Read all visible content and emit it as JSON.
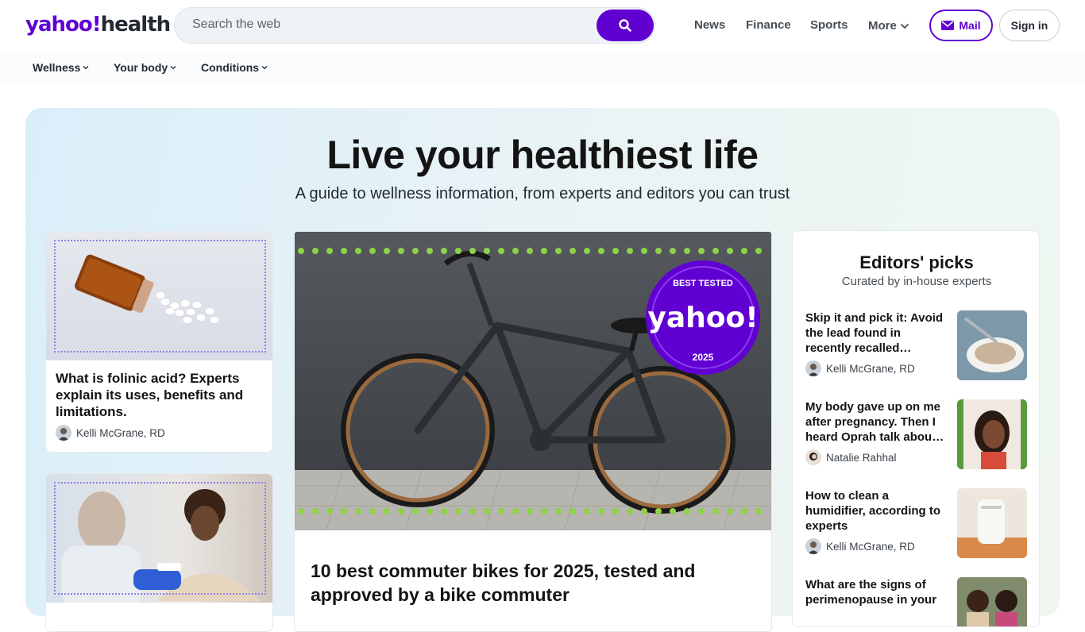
{
  "header": {
    "logo_brand": "yahoo!",
    "logo_section": "health",
    "search_placeholder": "Search the web",
    "nav": [
      "News",
      "Finance",
      "Sports",
      "More"
    ],
    "mail_label": "Mail",
    "signin_label": "Sign in"
  },
  "subnav": [
    "Wellness",
    "Your body",
    "Conditions"
  ],
  "hero": {
    "title": "Live your healthiest life",
    "subtitle": "A guide to wellness information, from experts and editors you can trust"
  },
  "left_cards": [
    {
      "title": "What is folinic acid? Experts explain its uses, benefits and limitations.",
      "author": "Kelli McGrane, RD"
    }
  ],
  "main_story": {
    "title": "10 best commuter bikes for 2025, tested and approved by a bike commuter",
    "badge_top": "BEST TESTED",
    "badge_brand": "yahoo!",
    "badge_year": "2025"
  },
  "editors_picks": {
    "title": "Editors' picks",
    "subtitle": "Curated by in-house experts",
    "items": [
      {
        "title": "Skip it and pick it: Avoid the lead found in recently recalled…",
        "author": "Kelli McGrane, RD"
      },
      {
        "title": "My body gave up on me after pregnancy. Then I heard Oprah talk abou…",
        "author": "Natalie Rahhal"
      },
      {
        "title": "How to clean a humidifier, according to experts",
        "author": "Kelli McGrane, RD"
      },
      {
        "title": "What are the signs of perimenopause in your",
        "author": ""
      }
    ]
  },
  "colors": {
    "brand": "#6001d2",
    "hero_bg": "#e3f1f6",
    "dots_green": "#8ed24a"
  }
}
